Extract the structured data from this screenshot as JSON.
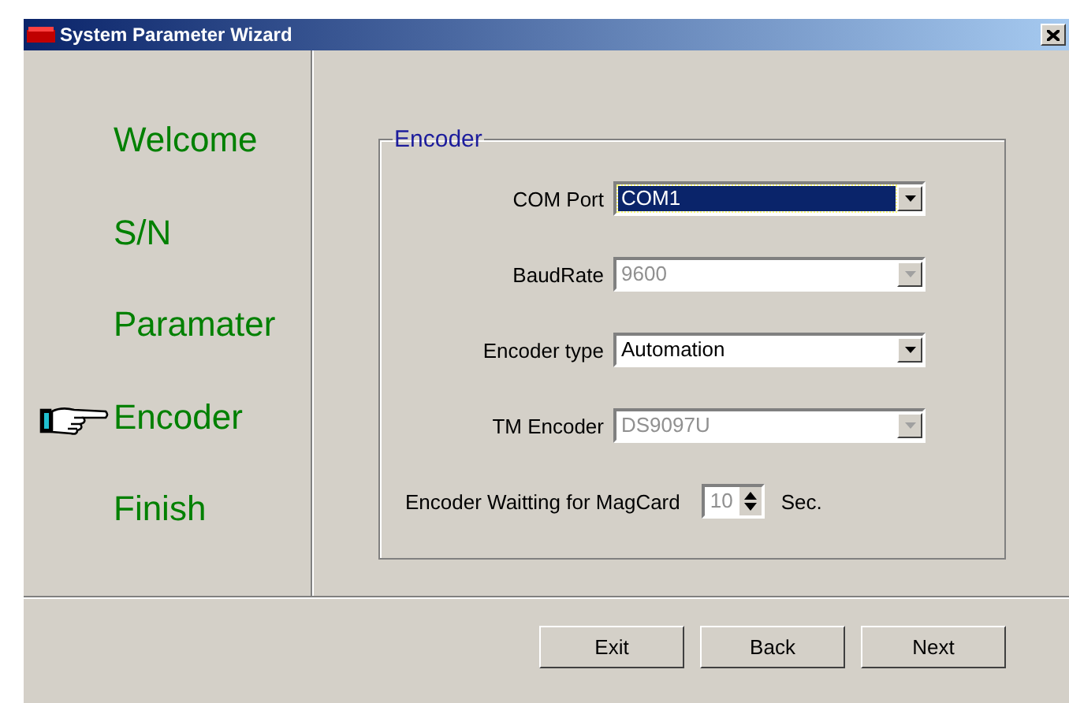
{
  "window": {
    "title": "System Parameter Wizard"
  },
  "steps": [
    {
      "label": "Welcome",
      "selected": false
    },
    {
      "label": "S/N",
      "selected": false
    },
    {
      "label": "Paramater",
      "selected": false
    },
    {
      "label": "Encoder",
      "selected": true
    },
    {
      "label": "Finish",
      "selected": false
    }
  ],
  "group": {
    "title": "Encoder",
    "fields": [
      {
        "kind": "combo",
        "label": "COM Port",
        "value": "COM1",
        "disabled": false,
        "focused": true
      },
      {
        "kind": "combo",
        "label": "BaudRate",
        "value": "9600",
        "disabled": true,
        "focused": false
      },
      {
        "kind": "combo",
        "label": "Encoder type",
        "value": "Automation",
        "disabled": false,
        "focused": false
      },
      {
        "kind": "combo",
        "label": "TM Encoder",
        "value": "DS9097U",
        "disabled": true,
        "focused": false
      },
      {
        "kind": "spinner",
        "label": "Encoder Waitting for MagCard",
        "value": "10",
        "unit": "Sec.",
        "disabled": true,
        "focused": false
      }
    ]
  },
  "buttons": [
    "Exit",
    "Back",
    "Next"
  ]
}
